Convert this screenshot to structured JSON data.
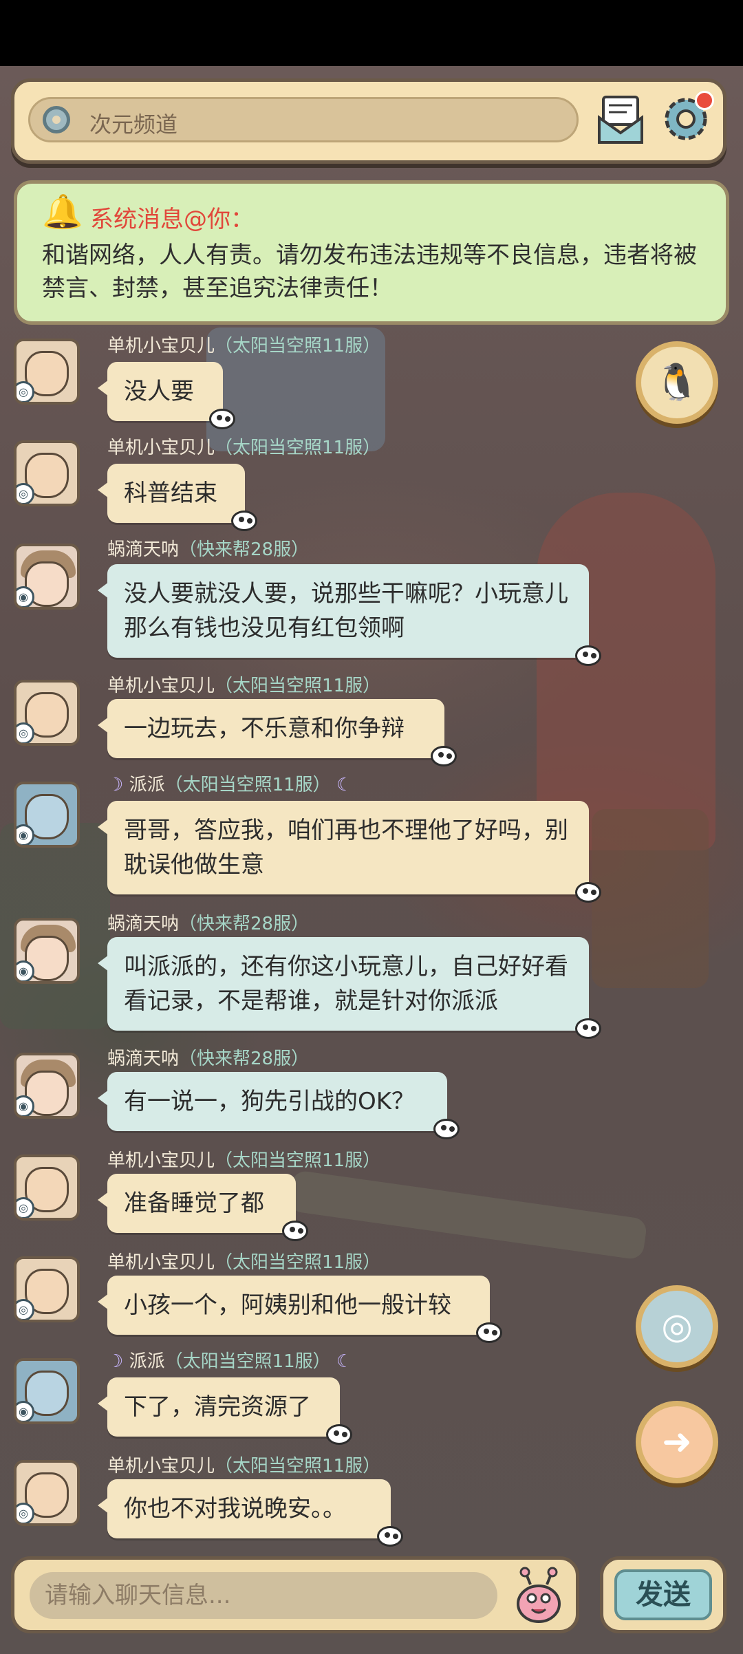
{
  "header": {
    "channel_title": "次元频道"
  },
  "system": {
    "title": "系统消息@你：",
    "body": "和谐网络，人人有责。请勿发布违法违规等不良信息，违者将被禁言、封禁，甚至追究法律责任！"
  },
  "messages": [
    {
      "name": "单机小宝贝儿",
      "server": "（太阳当空照11服）",
      "text": "没人要"
    },
    {
      "name": "单机小宝贝儿",
      "server": "（太阳当空照11服）",
      "text": "科普结束"
    },
    {
      "name": "蜗滴天呐",
      "server": "（快来帮28服）",
      "text": "没人要就没人要，说那些干嘛呢？小玩意儿那么有钱也没见有红包领啊"
    },
    {
      "name": "单机小宝贝儿",
      "server": "（太阳当空照11服）",
      "text": "一边玩去，不乐意和你争辩"
    },
    {
      "name": "派派",
      "server": "（太阳当空照11服）",
      "text": "哥哥，答应我，咱们再也不理他了好吗，别耽误他做生意"
    },
    {
      "name": "蜗滴天呐",
      "server": "（快来帮28服）",
      "text": "叫派派的，还有你这小玩意儿，自己好好看看记录，不是帮谁，就是针对你派派"
    },
    {
      "name": "蜗滴天呐",
      "server": "（快来帮28服）",
      "text": "有一说一，狗先引战的OK？"
    },
    {
      "name": "单机小宝贝儿",
      "server": "（太阳当空照11服）",
      "text": "准备睡觉了都"
    },
    {
      "name": "单机小宝贝儿",
      "server": "（太阳当空照11服）",
      "text": "小孩一个，阿姨别和他一般计较"
    },
    {
      "name": "派派",
      "server": "（太阳当空照11服）",
      "text": "下了，清完资源了"
    },
    {
      "name": "单机小宝贝儿",
      "server": "（太阳当空照11服）",
      "text": "你也不对我说晚安。。"
    }
  ],
  "input": {
    "placeholder": "请输入聊天信息..."
  },
  "send_label": "发送",
  "icons": [
    "channel-icon",
    "mail-icon",
    "gear-icon",
    "bell-icon",
    "qq-penguin-icon",
    "portal-icon",
    "arrow-right-icon",
    "snail-emoji-icon"
  ],
  "colors": {
    "header_bg": "#f6e2b5",
    "system_bg": "#d8efb8",
    "system_title": "#e1473a",
    "bubble_cream": "#f5e6c2",
    "bubble_blue": "#d7ebe7",
    "server_text": "#a6d6c7",
    "send_bg": "#9fd3d7"
  }
}
